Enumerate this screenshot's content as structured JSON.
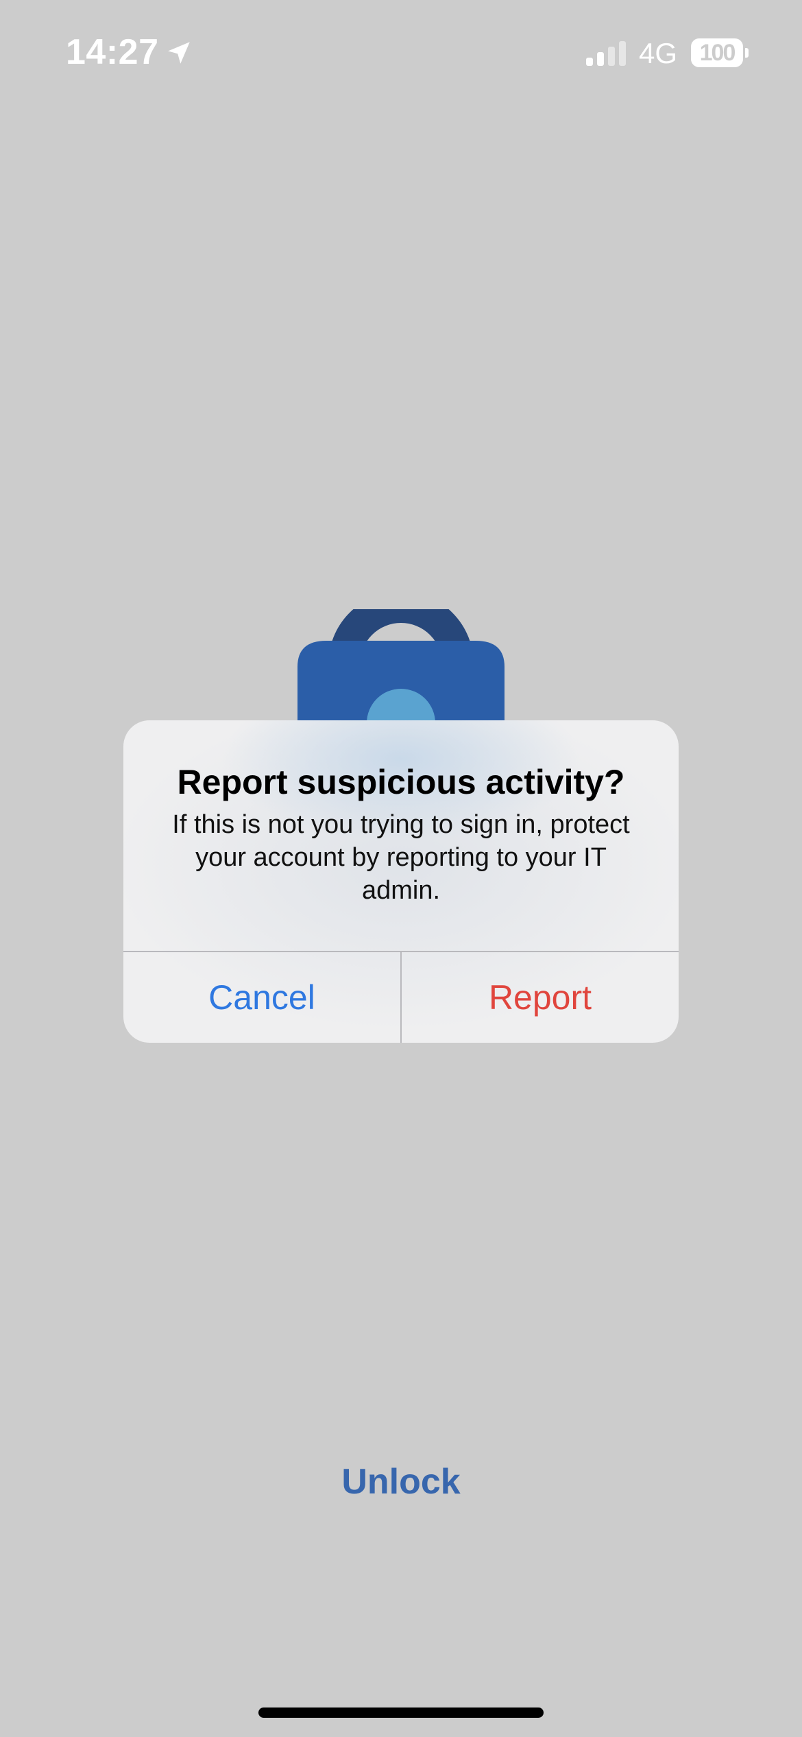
{
  "status_bar": {
    "time": "14:27",
    "network": "4G",
    "battery_level": "100",
    "icons": {
      "location": "location-arrow-icon",
      "signal": "cellular-signal-icon",
      "battery": "battery-icon"
    }
  },
  "illustration": {
    "icon": "padlock-icon",
    "colors": {
      "shackle": "#27477a",
      "body": "#2b5ea8",
      "keyhole": "#5aa3d0"
    }
  },
  "alert": {
    "title": "Report suspicious activity?",
    "message": "If this is not you trying to sign in, protect your account by reporting to your IT admin.",
    "cancel_label": "Cancel",
    "report_label": "Report",
    "colors": {
      "cancel": "#2f78e0",
      "report": "#e0453d"
    }
  },
  "footer": {
    "unlock_label": "Unlock",
    "unlock_color": "#3766ad"
  },
  "colors": {
    "background": "#cccccc",
    "dialog_background": "#efeff0"
  }
}
